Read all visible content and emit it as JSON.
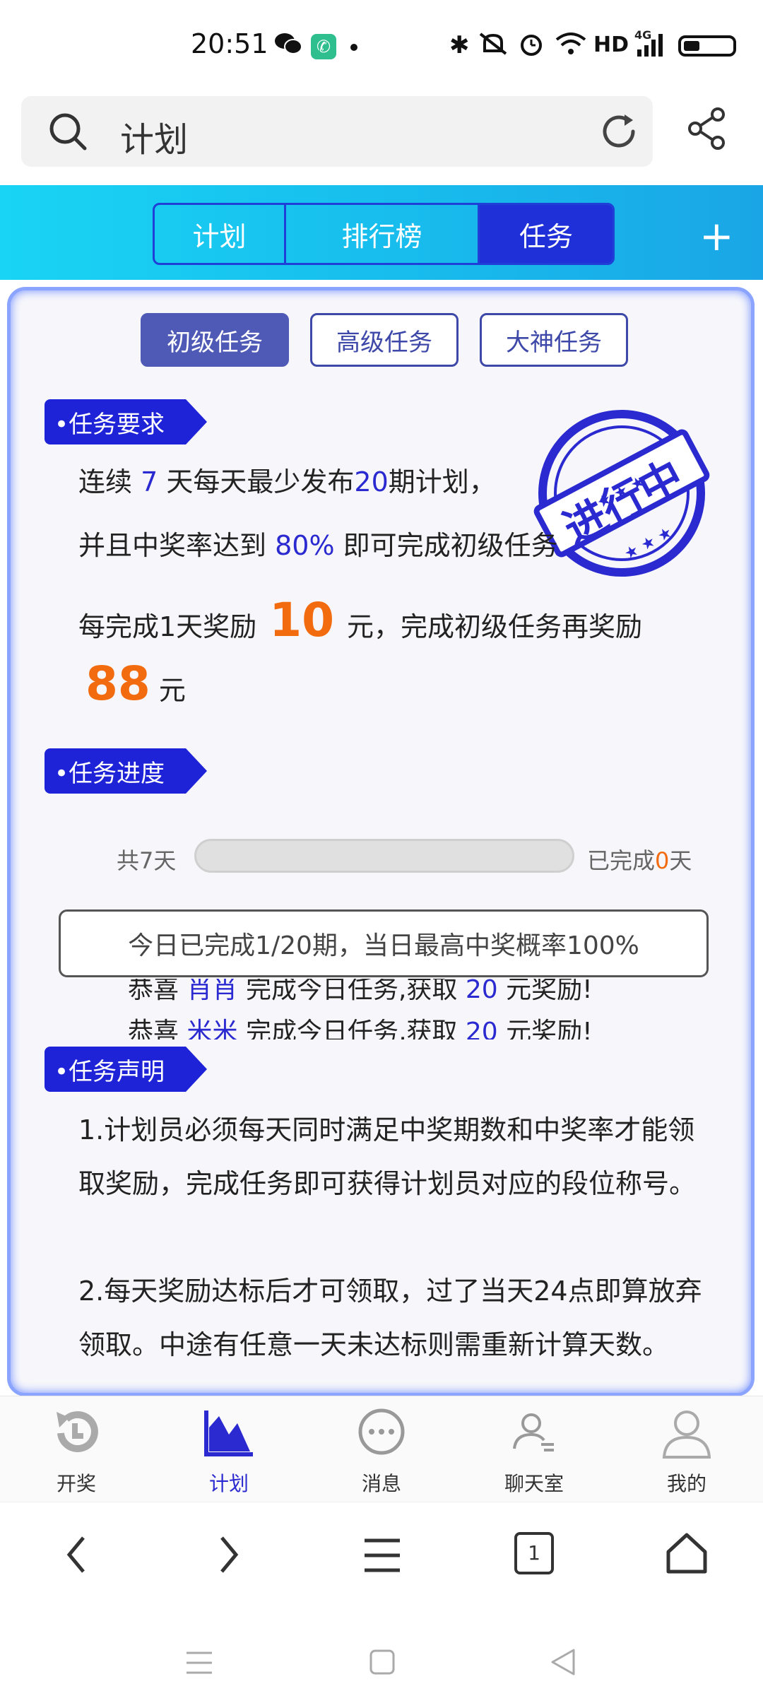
{
  "status_bar": {
    "time": "20:51",
    "indicators": [
      "wechat-icon",
      "phone-call-icon",
      "bluetooth-icon",
      "mute-icon",
      "alarm-icon",
      "wifi-icon",
      "hd-badge",
      "signal-4g-icon",
      "battery-icon"
    ],
    "hd": "HD",
    "network": "4G"
  },
  "search": {
    "query": "计划"
  },
  "top_tabs": [
    {
      "label": "计划",
      "active": false
    },
    {
      "label": "排行榜",
      "active": false
    },
    {
      "label": "任务",
      "active": true
    }
  ],
  "levels": [
    {
      "label": "初级任务",
      "active": true
    },
    {
      "label": "高级任务",
      "active": false
    },
    {
      "label": "大神任务",
      "active": false
    }
  ],
  "stamp": {
    "text": "进行中"
  },
  "requirement": {
    "title": "任务要求",
    "line1_a": "连续",
    "days": "7",
    "line1_b": "天每天最少发布",
    "periods": "20",
    "line1_c": "期计划，",
    "line2_a": "并且中奖率达到",
    "rate": "80%",
    "line2_b": "即可完成初级任务",
    "line3_a": "每完成1天奖励",
    "daily_reward": "10",
    "line3_b": "元，完成初级任务再奖励",
    "final_reward": "88",
    "unit": "元"
  },
  "progress": {
    "title": "任务进度",
    "total_label": "共7天",
    "done_prefix": "已完成",
    "done_days": "0",
    "done_suffix": "天",
    "fraction": 0,
    "today": "今日已完成1/20期，当日最高中奖概率100%"
  },
  "ticker": {
    "line1_a": "恭喜",
    "line1_name": "肖肖",
    "line1_b": "完成今日任务,获取",
    "line1_amount": "20",
    "line1_c": "元奖励!",
    "line2_a": "恭喜",
    "line2_name": "米米",
    "line2_b": "完成今日任务,获取",
    "line2_amount": "20",
    "line2_c": "元奖励!"
  },
  "statement": {
    "title": "任务声明",
    "p1": "1.计划员必须每天同时满足中奖期数和中奖率才能领取奖励，完成任务即可获得计划员对应的段位称号。",
    "p2": "2.每天奖励达标后才可领取，过了当天24点即算放弃领取。中途有任意一天未达标则需重新计算天数。"
  },
  "bottom_nav": [
    {
      "label": "开奖",
      "icon": "lottery-draw-icon",
      "active": false
    },
    {
      "label": "计划",
      "icon": "chart-icon",
      "active": true
    },
    {
      "label": "消息",
      "icon": "message-icon",
      "active": false
    },
    {
      "label": "聊天室",
      "icon": "chatroom-icon",
      "active": false
    },
    {
      "label": "我的",
      "icon": "profile-icon",
      "active": false
    }
  ],
  "browser_bar": {
    "tab_count": "1"
  },
  "colors": {
    "accent_blue": "#1f23d8",
    "highlight_orange": "#f26b0f",
    "band_cyan": "#19d4f4"
  }
}
